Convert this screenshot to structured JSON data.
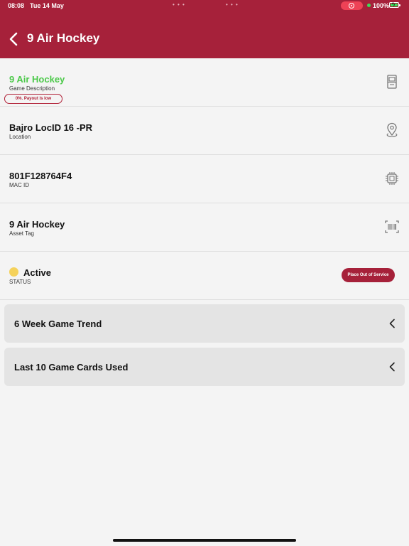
{
  "status_bar": {
    "time": "08:08",
    "date": "Tue 14 May",
    "battery": "100%"
  },
  "header": {
    "title": "9 Air Hockey",
    "background": "#a6213a"
  },
  "rows": {
    "game": {
      "value": "9 Air Hockey",
      "label": "Game Description",
      "badge": "0%. Payout is low",
      "icon": "arcade-machine-icon",
      "value_color": "#4cc94a"
    },
    "location": {
      "value": "Bajro LocID 16 -PR",
      "label": "Location",
      "icon": "map-pin-icon"
    },
    "mac": {
      "value": "801F128764F4",
      "label": "MAC ID",
      "icon": "chip-icon"
    },
    "asset": {
      "value": "9 Air Hockey",
      "label": "Asset Tag",
      "icon": "barcode-icon"
    },
    "status": {
      "value": "Active",
      "label": "STATUS",
      "button": "Place Out of Service",
      "dot_color": "#f5d25b"
    }
  },
  "cards": [
    {
      "label": "6 Week Game Trend",
      "icon": "chevron-left-icon"
    },
    {
      "label": "Last 10 Game Cards Used",
      "icon": "chevron-left-icon"
    }
  ]
}
